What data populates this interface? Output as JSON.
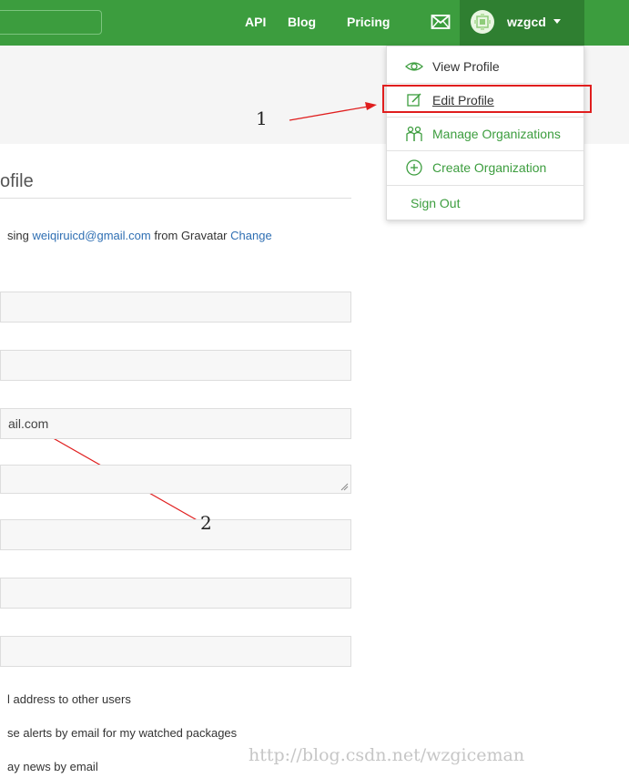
{
  "nav": {
    "links": [
      "API",
      "Blog",
      "Pricing"
    ],
    "user": "wzgcd"
  },
  "dropdown": {
    "items": [
      "View Profile",
      "Edit Profile",
      "Manage Organizations",
      "Create Organization",
      "Sign Out"
    ]
  },
  "annotations": {
    "one": "1",
    "two": "2"
  },
  "profile": {
    "heading": "ofile",
    "gravatar_prefix": "sing ",
    "gravatar_email": "weiqiruicd@gmail.com",
    "gravatar_middle": " from Gravatar ",
    "gravatar_change": "Change",
    "email_value": "ail.com",
    "checkbox_labels": [
      "l address to other users",
      "se alerts by email for my watched packages",
      "ay news by email"
    ]
  },
  "watermark": "http://blog.csdn.net/wzgiceman",
  "colors": {
    "nav_green": "#3c9d3e",
    "user_bg": "#2f7f31",
    "highlight_red": "#e01e1e",
    "link_blue": "#2f6fb3"
  }
}
